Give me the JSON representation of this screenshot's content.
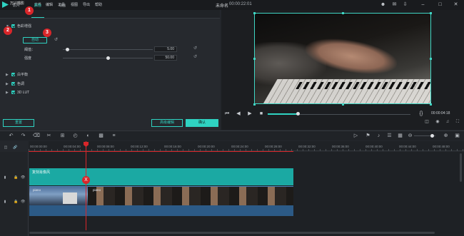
{
  "app": {
    "logo_text": "万兴喵影",
    "menu": [
      "文件",
      "编辑",
      "工具",
      "视图",
      "导出",
      "帮助"
    ],
    "doc_title": "未命名",
    "doc_time": "00:00:22:01"
  },
  "window_icons": [
    "user-icon",
    "mail-icon",
    "download-icon",
    "minimize-icon",
    "restore-icon",
    "close-icon"
  ],
  "tabs": [
    {
      "label": "影片",
      "active": false
    },
    {
      "label": "颜色",
      "active": true
    },
    {
      "label": "动画",
      "active": false
    }
  ],
  "color_panel": {
    "enhance_label": "色彩增强",
    "auto_button": "自动",
    "params": [
      {
        "label": "阈值：",
        "value": "5.00",
        "fraction": 0.05
      },
      {
        "label": "强度",
        "value": "50.00",
        "fraction": 0.5
      }
    ],
    "sections": [
      "白平衡",
      "色调",
      "3D LUT"
    ],
    "reset_button": "重置",
    "advanced_button": "高级编辑",
    "ok_button": "确认"
  },
  "callouts": [
    "1",
    "2",
    "3"
  ],
  "preview": {
    "timecode": "00:00:04:18",
    "progress": 0.21
  },
  "ruler": {
    "ticks": [
      "00:00:00:00",
      "00:00:04:00",
      "00:00:08:00",
      "00:00:12:00",
      "00:00:16:00",
      "00:00:20:00",
      "00:00:24:00",
      "00:00:28:00",
      "00:00:32:00",
      "00:00:36:00",
      "00:00:40:00",
      "00:00:44:00",
      "00:00:48:00",
      "00:00:52:00"
    ]
  },
  "timeline": {
    "fx_clip_label": "复刻肖像风",
    "clip_name_1": "piano",
    "clip_name_2": "piano",
    "split_marker": "X"
  },
  "colors": {
    "accent": "#2fd3c2",
    "callout": "#d9262a",
    "fx_clip": "#1ba9a3",
    "video_clip": "#2c5a86"
  }
}
